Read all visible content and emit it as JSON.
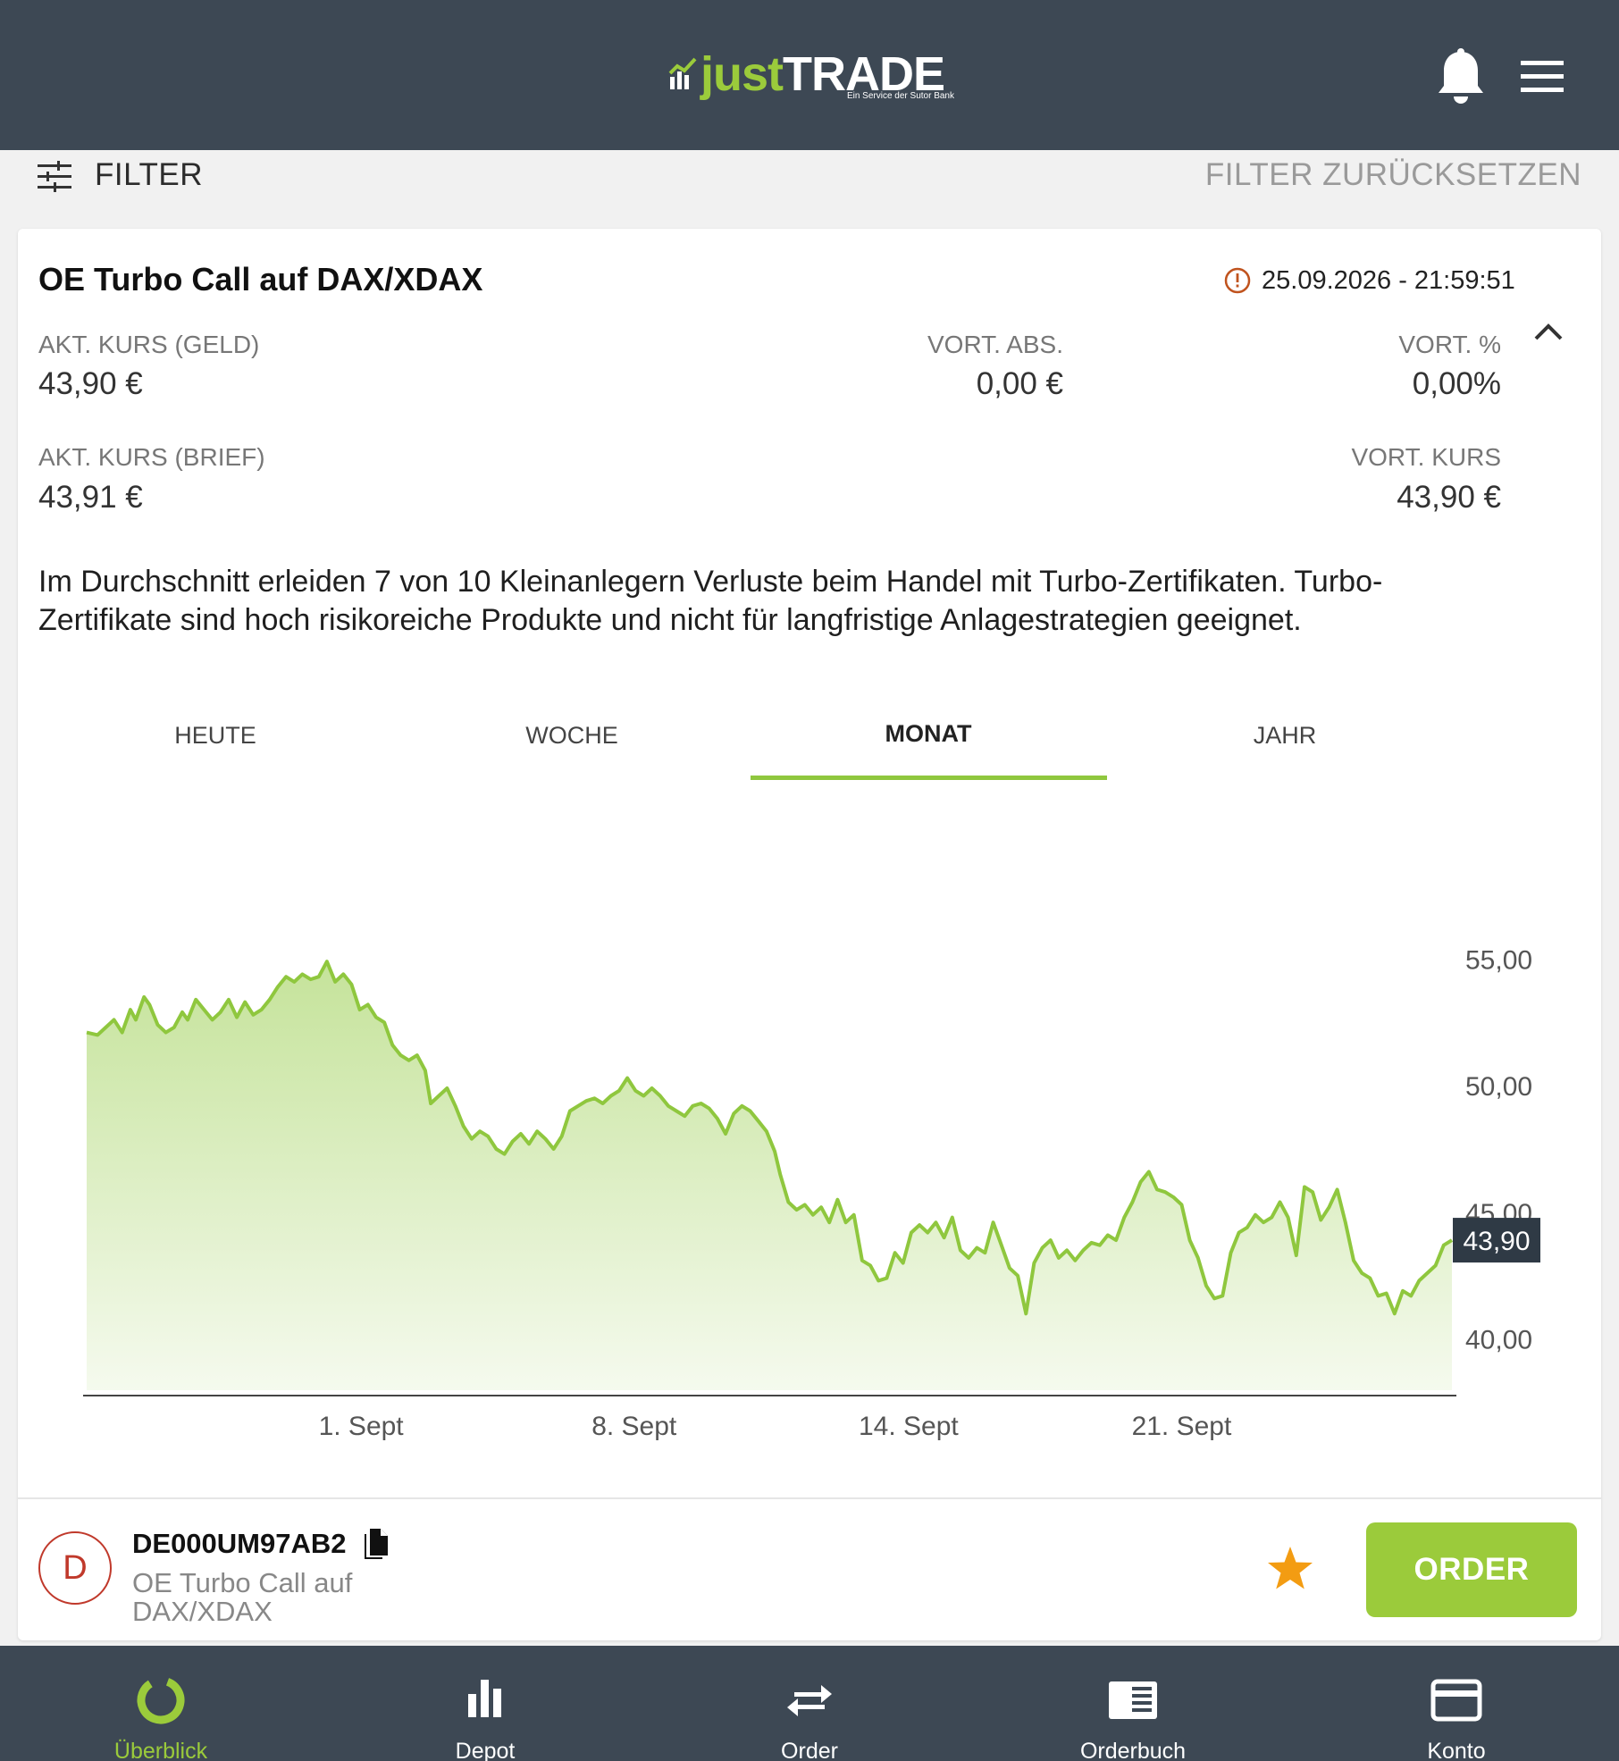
{
  "header": {
    "logo_just": "just",
    "logo_trade": "TRADE",
    "logo_sub": "Ein Service der Sutor Bank",
    "bell_icon": "bell-icon",
    "menu_icon": "hamburger-menu-icon"
  },
  "filter": {
    "label": "FILTER",
    "reset_label": "FILTER ZURÜCKSETZEN",
    "icon": "sliders-icon"
  },
  "instrument": {
    "title": "OE Turbo Call auf DAX/XDAX",
    "timestamp": "25.09.2026 - 21:59:51",
    "timestamp_icon": "alert-circle-icon",
    "bid_label": "AKT. KURS (GELD)",
    "bid_value": "43,90 €",
    "change_abs_label": "VORT. ABS.",
    "change_abs_value": "0,00 €",
    "change_pct_label": "VORT. %",
    "change_pct_value": "0,00%",
    "ask_label": "AKT. KURS (BRIEF)",
    "ask_value": "43,91 €",
    "prev_label": "VORT. KURS",
    "prev_value": "43,90 €",
    "disclaimer": "Im Durchschnitt erleiden 7 von 10 Kleinanlegern Verluste beim Handel mit Turbo-Zertifikaten. Turbo-Zertifikate sind hoch risikoreiche Produkte und nicht für langfristige Anlagestrategien geeignet."
  },
  "tabs": [
    {
      "label": "HEUTE"
    },
    {
      "label": "WOCHE"
    },
    {
      "label": "MONAT",
      "active": true
    },
    {
      "label": "JAHR"
    }
  ],
  "chart_data": {
    "type": "area",
    "color": "#8fc73e",
    "fill_top": "#c5e39a",
    "fill_bottom": "#f5faee",
    "ylim": [
      37.8,
      59.0
    ],
    "xlim": [
      0,
      100
    ],
    "y_ticks": [
      {
        "value": 55,
        "label": "55,00"
      },
      {
        "value": 50,
        "label": "50,00"
      },
      {
        "value": 45,
        "label": "45,00"
      },
      {
        "value": 40,
        "label": "40,00"
      }
    ],
    "x_ticks": [
      {
        "value": 20.1,
        "label": "1. Sept"
      },
      {
        "value": 40.1,
        "label": "8. Sept"
      },
      {
        "value": 60.2,
        "label": "14. Sept"
      },
      {
        "value": 80.2,
        "label": "21. Sept"
      }
    ],
    "current_value_label": "43,90",
    "current_value": 43.9,
    "points": [
      [
        0.0,
        52.1
      ],
      [
        0.8,
        52.0
      ],
      [
        1.4,
        52.3
      ],
      [
        2.0,
        52.6
      ],
      [
        2.6,
        52.1
      ],
      [
        3.2,
        53.0
      ],
      [
        3.6,
        52.6
      ],
      [
        4.2,
        53.5
      ],
      [
        4.6,
        53.2
      ],
      [
        5.2,
        52.4
      ],
      [
        5.8,
        52.1
      ],
      [
        6.4,
        52.3
      ],
      [
        7.0,
        52.9
      ],
      [
        7.4,
        52.6
      ],
      [
        8.0,
        53.4
      ],
      [
        8.6,
        53.0
      ],
      [
        9.2,
        52.6
      ],
      [
        9.8,
        52.9
      ],
      [
        10.4,
        53.4
      ],
      [
        11.0,
        52.7
      ],
      [
        11.6,
        53.3
      ],
      [
        12.2,
        52.8
      ],
      [
        12.8,
        53.0
      ],
      [
        13.4,
        53.4
      ],
      [
        14.0,
        53.9
      ],
      [
        14.6,
        54.3
      ],
      [
        15.2,
        54.1
      ],
      [
        15.8,
        54.4
      ],
      [
        16.4,
        54.2
      ],
      [
        17.0,
        54.3
      ],
      [
        17.6,
        54.9
      ],
      [
        18.2,
        54.1
      ],
      [
        18.8,
        54.4
      ],
      [
        19.4,
        54.0
      ],
      [
        20.0,
        53.0
      ],
      [
        20.6,
        53.2
      ],
      [
        21.2,
        52.7
      ],
      [
        21.8,
        52.5
      ],
      [
        22.4,
        51.6
      ],
      [
        23.0,
        51.2
      ],
      [
        23.6,
        51.0
      ],
      [
        24.2,
        51.2
      ],
      [
        24.8,
        50.6
      ],
      [
        25.2,
        49.3
      ],
      [
        25.8,
        49.6
      ],
      [
        26.4,
        49.9
      ],
      [
        27.0,
        49.2
      ],
      [
        27.6,
        48.4
      ],
      [
        28.2,
        47.9
      ],
      [
        28.8,
        48.2
      ],
      [
        29.4,
        48.0
      ],
      [
        30.0,
        47.5
      ],
      [
        30.6,
        47.3
      ],
      [
        31.2,
        47.8
      ],
      [
        31.8,
        48.1
      ],
      [
        32.4,
        47.7
      ],
      [
        33.0,
        48.2
      ],
      [
        33.6,
        47.9
      ],
      [
        34.2,
        47.5
      ],
      [
        34.8,
        48.0
      ],
      [
        35.4,
        49.0
      ],
      [
        36.0,
        49.2
      ],
      [
        36.6,
        49.4
      ],
      [
        37.2,
        49.5
      ],
      [
        37.8,
        49.3
      ],
      [
        38.4,
        49.6
      ],
      [
        39.0,
        49.8
      ],
      [
        39.6,
        50.3
      ],
      [
        40.2,
        49.8
      ],
      [
        40.8,
        49.6
      ],
      [
        41.4,
        49.9
      ],
      [
        42.0,
        49.6
      ],
      [
        42.6,
        49.2
      ],
      [
        43.2,
        49.0
      ],
      [
        43.8,
        48.8
      ],
      [
        44.4,
        49.2
      ],
      [
        45.0,
        49.3
      ],
      [
        45.6,
        49.1
      ],
      [
        46.2,
        48.7
      ],
      [
        46.8,
        48.1
      ],
      [
        47.4,
        48.9
      ],
      [
        48.0,
        49.2
      ],
      [
        48.6,
        49.0
      ],
      [
        49.2,
        48.6
      ],
      [
        49.8,
        48.2
      ],
      [
        50.4,
        47.4
      ],
      [
        50.8,
        46.5
      ],
      [
        51.4,
        45.4
      ],
      [
        52.0,
        45.1
      ],
      [
        52.6,
        45.3
      ],
      [
        53.2,
        44.9
      ],
      [
        53.8,
        45.2
      ],
      [
        54.4,
        44.6
      ],
      [
        55.0,
        45.5
      ],
      [
        55.6,
        44.6
      ],
      [
        56.2,
        44.9
      ],
      [
        56.8,
        43.1
      ],
      [
        57.4,
        42.9
      ],
      [
        58.0,
        42.3
      ],
      [
        58.6,
        42.4
      ],
      [
        59.2,
        43.4
      ],
      [
        59.8,
        43.0
      ],
      [
        60.4,
        44.2
      ],
      [
        61.0,
        44.5
      ],
      [
        61.6,
        44.2
      ],
      [
        62.2,
        44.6
      ],
      [
        62.8,
        44.0
      ],
      [
        63.4,
        44.8
      ],
      [
        64.0,
        43.5
      ],
      [
        64.6,
        43.2
      ],
      [
        65.2,
        43.6
      ],
      [
        65.8,
        43.4
      ],
      [
        66.4,
        44.6
      ],
      [
        67.0,
        43.7
      ],
      [
        67.6,
        42.8
      ],
      [
        68.2,
        42.5
      ],
      [
        68.8,
        41.0
      ],
      [
        69.4,
        43.0
      ],
      [
        70.0,
        43.6
      ],
      [
        70.6,
        43.9
      ],
      [
        71.2,
        43.2
      ],
      [
        71.8,
        43.5
      ],
      [
        72.4,
        43.1
      ],
      [
        73.0,
        43.5
      ],
      [
        73.6,
        43.8
      ],
      [
        74.2,
        43.7
      ],
      [
        74.8,
        44.1
      ],
      [
        75.4,
        43.9
      ],
      [
        76.0,
        44.8
      ],
      [
        76.6,
        45.4
      ],
      [
        77.2,
        46.2
      ],
      [
        77.8,
        46.6
      ],
      [
        78.4,
        45.9
      ],
      [
        79.0,
        45.8
      ],
      [
        79.6,
        45.6
      ],
      [
        80.2,
        45.3
      ],
      [
        80.8,
        43.9
      ],
      [
        81.4,
        43.2
      ],
      [
        82.0,
        42.1
      ],
      [
        82.6,
        41.6
      ],
      [
        83.2,
        41.7
      ],
      [
        83.8,
        43.4
      ],
      [
        84.4,
        44.2
      ],
      [
        85.0,
        44.4
      ],
      [
        85.6,
        44.9
      ],
      [
        86.2,
        44.6
      ],
      [
        86.8,
        44.8
      ],
      [
        87.4,
        45.4
      ],
      [
        88.0,
        44.8
      ],
      [
        88.6,
        43.3
      ],
      [
        89.2,
        46.0
      ],
      [
        89.8,
        45.8
      ],
      [
        90.4,
        44.7
      ],
      [
        91.0,
        45.2
      ],
      [
        91.6,
        45.9
      ],
      [
        92.2,
        44.6
      ],
      [
        92.8,
        43.1
      ],
      [
        93.4,
        42.6
      ],
      [
        94.0,
        42.4
      ],
      [
        94.6,
        41.7
      ],
      [
        95.2,
        41.8
      ],
      [
        95.8,
        41.0
      ],
      [
        96.4,
        41.9
      ],
      [
        97.0,
        41.7
      ],
      [
        97.6,
        42.3
      ],
      [
        98.2,
        42.6
      ],
      [
        98.8,
        42.9
      ],
      [
        99.4,
        43.7
      ],
      [
        100.0,
        43.9
      ]
    ]
  },
  "footer": {
    "issuer_letter": "D",
    "isin": "DE000UM97AB2",
    "copy_icon": "copy-icon",
    "product_name": "OE Turbo Call auf DAX/XDAX",
    "favorite_icon": "star-icon",
    "order_label": "ORDER"
  },
  "bottom_nav": [
    {
      "label": "Überblick",
      "icon": "overview-ring-icon",
      "active": true
    },
    {
      "label": "Depot",
      "icon": "bar-chart-icon"
    },
    {
      "label": "Order",
      "icon": "swap-arrows-icon"
    },
    {
      "label": "Orderbuch",
      "icon": "order-book-icon"
    },
    {
      "label": "Konto",
      "icon": "credit-card-icon"
    }
  ]
}
